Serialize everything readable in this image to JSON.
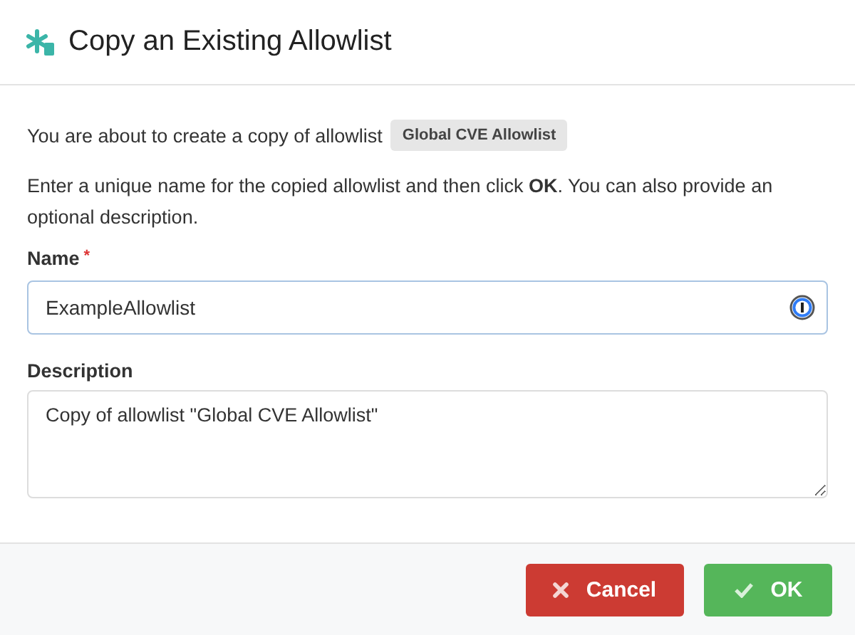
{
  "dialog": {
    "title": "Copy an Existing Allowlist"
  },
  "intro": {
    "text": "You are about to create a copy of allowlist",
    "tag": "Global CVE Allowlist"
  },
  "instructions": "Enter a unique name for the copied allowlist and then click **OK**. You can also provide an optional description.",
  "name_field": {
    "label": "Name",
    "required_mark": "*",
    "value": "ExampleAllowlist"
  },
  "description_field": {
    "label": "Description",
    "value": "Copy of allowlist \"Global CVE Allowlist\""
  },
  "buttons": [
    {
      "kind": "cancel",
      "label": "Cancel"
    },
    {
      "kind": "ok",
      "label": "OK"
    }
  ]
}
